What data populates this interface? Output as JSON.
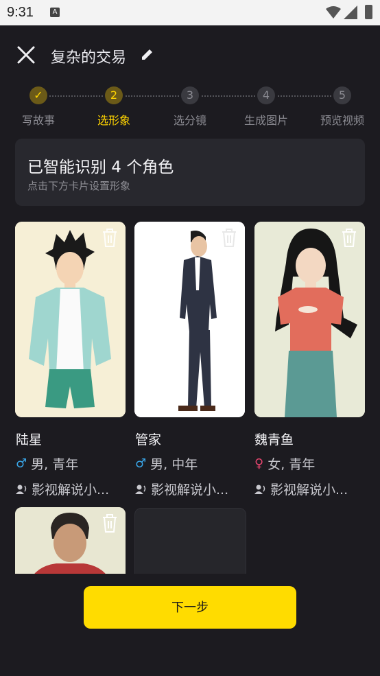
{
  "status_bar": {
    "time": "9:31",
    "notification_glyph": "A"
  },
  "header": {
    "title": "复杂的交易"
  },
  "steps": [
    {
      "number": "✓",
      "label": "写故事",
      "state": "done"
    },
    {
      "number": "2",
      "label": "选形象",
      "state": "active"
    },
    {
      "number": "3",
      "label": "选分镜",
      "state": "todo"
    },
    {
      "number": "4",
      "label": "生成图片",
      "state": "todo"
    },
    {
      "number": "5",
      "label": "预览视频",
      "state": "todo"
    }
  ],
  "info": {
    "title": "已智能识别 4 个角色",
    "subtitle": "点击下方卡片设置形象"
  },
  "characters": [
    {
      "name": "陆星",
      "gender_symbol": "♂",
      "attributes": "男, 青年",
      "voice": "影视解说小..."
    },
    {
      "name": "管家",
      "gender_symbol": "♂",
      "attributes": "男, 中年",
      "voice": "影视解说小..."
    },
    {
      "name": "魏青鱼",
      "gender_symbol": "♀",
      "attributes": "女, 青年",
      "voice": "影视解说小..."
    },
    {
      "name": "",
      "gender_symbol": "",
      "attributes": "",
      "voice": ""
    }
  ],
  "footer": {
    "next_label": "下一步"
  },
  "colors": {
    "accent": "#ffdc00",
    "background": "#1c1b20",
    "card": "#28282e",
    "male": "#39a6e8",
    "female": "#e8466f"
  }
}
